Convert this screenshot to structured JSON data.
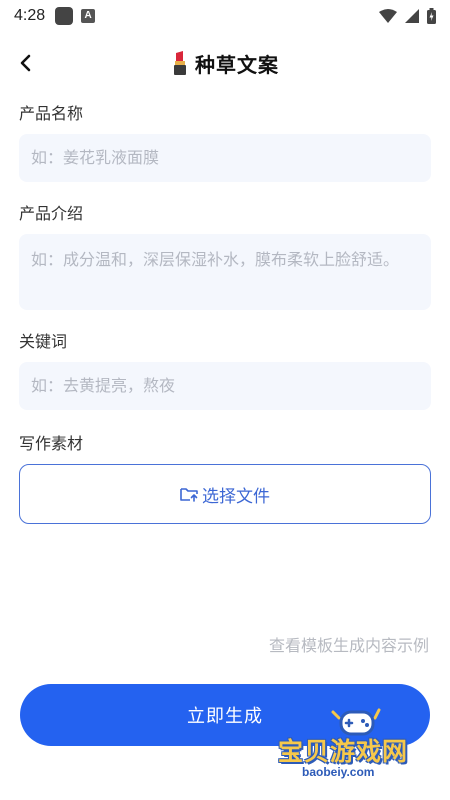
{
  "status_bar": {
    "time": "4:28",
    "app_badge": "A"
  },
  "header": {
    "title": "种草文案",
    "title_icon": "lipstick-icon",
    "back_icon": "chevron-left-icon"
  },
  "form": {
    "product_name": {
      "label": "产品名称",
      "placeholder": "如：姜花乳液面膜",
      "value": ""
    },
    "product_intro": {
      "label": "产品介绍",
      "placeholder": "如：成分温和，深层保湿补水，膜布柔软上脸舒适。",
      "value": ""
    },
    "keywords": {
      "label": "关键词",
      "placeholder": "如：去黄提亮，熬夜",
      "value": ""
    },
    "material": {
      "label": "写作素材",
      "button_label": "选择文件",
      "button_icon": "folder-upload-icon"
    }
  },
  "template_link": "查看模板生成内容示例",
  "generate_button": "立即生成",
  "watermark": {
    "text": "宝贝游戏网",
    "url": "baobeiy.com"
  },
  "colors": {
    "accent": "#2462f0",
    "input_bg": "#f4f7fd",
    "border": "#4a72d8",
    "placeholder": "#b4b8c2",
    "lipstick": "#d9263a"
  }
}
